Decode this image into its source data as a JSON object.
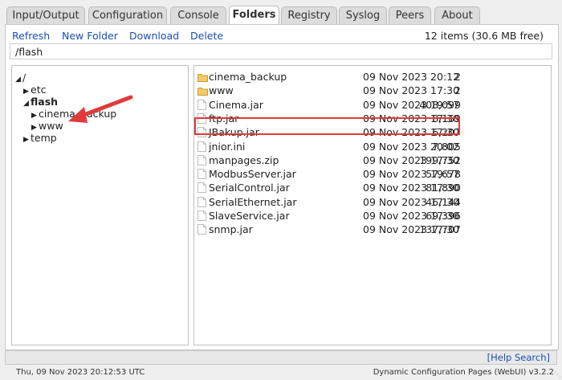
{
  "tabs": [
    {
      "label": "Input/Output",
      "active": false
    },
    {
      "label": "Configuration",
      "active": false
    },
    {
      "label": "Console",
      "active": false
    },
    {
      "label": "Folders",
      "active": true
    },
    {
      "label": "Registry",
      "active": false
    },
    {
      "label": "Syslog",
      "active": false
    },
    {
      "label": "Peers",
      "active": false
    },
    {
      "label": "About",
      "active": false
    }
  ],
  "toolbar": {
    "refresh": "Refresh",
    "new_folder": "New Folder",
    "download": "Download",
    "delete": "Delete",
    "items_count": "12 items (30.6 MB free)"
  },
  "path": "/flash",
  "tree": {
    "root": "/",
    "etc": "etc",
    "flash": "flash",
    "cinema_backup": "cinema_backup",
    "www": "www",
    "temp": "temp"
  },
  "files": [
    {
      "name": "cinema_backup",
      "size": "2",
      "date": "09 Nov 2023 20:12",
      "type": "folder"
    },
    {
      "name": "www",
      "size": "2",
      "date": "09 Nov 2023 17:30",
      "type": "folder"
    },
    {
      "name": "Cinema.jar",
      "size": "408,099",
      "date": "09 Nov 2023 19:57",
      "type": "file"
    },
    {
      "name": "ftp.jar",
      "size": "8,169",
      "date": "09 Nov 2023 17:30",
      "type": "file"
    },
    {
      "name": "JBakup.jar",
      "size": "6,207",
      "date": "09 Nov 2023 17:30",
      "type": "file"
    },
    {
      "name": "jnior.ini",
      "size": "7,805",
      "date": "09 Nov 2023 20:02",
      "type": "file"
    },
    {
      "name": "manpages.zip",
      "size": "199,752",
      "date": "09 Nov 2023 17:30",
      "type": "file"
    },
    {
      "name": "ModbusServer.jar",
      "size": "57,678",
      "date": "09 Nov 2023 19:57",
      "type": "file"
    },
    {
      "name": "SerialControl.jar",
      "size": "81,890",
      "date": "09 Nov 2023 17:30",
      "type": "file"
    },
    {
      "name": "SerialEthernet.jar",
      "size": "46,144",
      "date": "09 Nov 2023 17:30",
      "type": "file"
    },
    {
      "name": "SlaveService.jar",
      "size": "69,396",
      "date": "09 Nov 2023 17:30",
      "type": "file"
    },
    {
      "name": "snmp.jar",
      "size": "137,707",
      "date": "09 Nov 2023 17:30",
      "type": "file"
    }
  ],
  "help_link": "[Help Search]",
  "status": {
    "datetime": "Thu, 09 Nov 2023 20:12:53 UTC",
    "version": "Dynamic Configuration Pages (WebUI) v3.2.2"
  },
  "colors": {
    "link": "#1a4fb5",
    "highlight": "#e03b3b",
    "folder": "#e8b84a"
  }
}
